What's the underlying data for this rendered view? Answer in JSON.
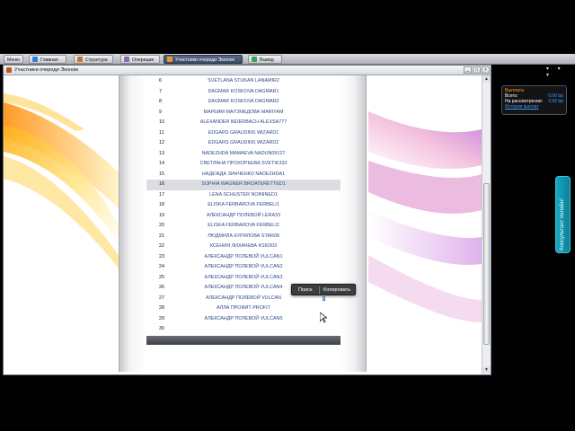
{
  "tabs": [
    {
      "label": "Меню",
      "active": false,
      "color": "#dcdde0"
    },
    {
      "label": "Главная",
      "active": false,
      "color": "#3a7bd5"
    },
    {
      "label": "Структура",
      "active": false,
      "color": "#d0712a"
    },
    {
      "label": "Операции",
      "active": false,
      "color": "#8a6bb8"
    },
    {
      "label": "Участники очереди Эконом",
      "active": true,
      "color": "#e89a2a"
    },
    {
      "label": "Вывод",
      "active": false,
      "color": "#3aa550"
    }
  ],
  "window": {
    "title": "Участники очереди Эконом",
    "minimize": "_",
    "maximize": "□",
    "close": "×"
  },
  "list": {
    "rows": [
      {
        "num": "6",
        "name": "SVETLANA STUKAN LANAMIR2",
        "selected": false
      },
      {
        "num": "7",
        "name": "DAGMAR KOSKOVA DAGMAR1",
        "selected": false
      },
      {
        "num": "8",
        "name": "DAGMAR KOSKOVA DAGMAR2",
        "selected": false
      },
      {
        "num": "9",
        "name": "МАРЬЯМ МАГОМЕДОВА MARIYAM",
        "selected": false
      },
      {
        "num": "10",
        "name": "ALEXANDER BEIERBACH ALEXSA777",
        "selected": false
      },
      {
        "num": "11",
        "name": "EDGARS GRAUDINS WIZARD1",
        "selected": false
      },
      {
        "num": "12",
        "name": "EDGARS GRAUDINS WIZARD2",
        "selected": false
      },
      {
        "num": "13",
        "name": "NADEZHDA MAMAEVA NADUN09127",
        "selected": false
      },
      {
        "num": "14",
        "name": "СВЕТЛАНА ПРОХОРЬЕВА SVETIK333",
        "selected": false
      },
      {
        "num": "15",
        "name": "НАДЕЖДА ЗИНЧЕНКО NADEZHDA1",
        "selected": false
      },
      {
        "num": "16",
        "name": "SOPHIA WAGNER BROATERETTED1",
        "selected": true
      },
      {
        "num": "17",
        "name": "LENA SCHUSTER NOININED1",
        "selected": false
      },
      {
        "num": "18",
        "name": "ELISKA FERBAROVA FERBELI1",
        "selected": false
      },
      {
        "num": "19",
        "name": "АЛЕКСАНДР ПОЛЕВОЙ LERA33",
        "selected": false
      },
      {
        "num": "20",
        "name": "ELISKA FERBAROVA FERBELI2",
        "selected": false
      },
      {
        "num": "21",
        "name": "ЛЮДМИЛА КУРИЛОВА STAR08",
        "selected": false
      },
      {
        "num": "22",
        "name": "КСЕНИЯ ЛИХАЧЕВА KSI0303",
        "selected": false
      },
      {
        "num": "23",
        "name": "АЛЕКСАНДР ПОЛЕВОЙ VULCAN1",
        "selected": false
      },
      {
        "num": "24",
        "name": "АЛЕКСАНДР ПОЛЕВОЙ VULCAN2",
        "selected": false
      },
      {
        "num": "25",
        "name": "АЛЕКСАНДР ПОЛЕВОЙ VULCAN3",
        "selected": false
      },
      {
        "num": "26",
        "name": "АЛЕКСАНДР ПОЛЕВОЙ VULCAN4",
        "selected": false
      },
      {
        "num": "27",
        "name": "АЛЕКСАНДР ПОЛЕВОЙ VULCAN",
        "selected": false
      },
      {
        "num": "28",
        "name": "АЛЛА ПРОФИТ PROFIT",
        "selected": false
      },
      {
        "num": "29",
        "name": "АЛЕКСАНДР ПОЛЕВОЙ VULCAN5",
        "selected": false
      },
      {
        "num": "30",
        "name": "",
        "selected": false
      }
    ]
  },
  "context_menu": {
    "search": "Поиск",
    "copy": "Копировать"
  },
  "balance": {
    "title": "Выплата",
    "total_label": "Всего:",
    "total_value": "0,00 bp",
    "review_label": "На рассмотрении:",
    "review_value": "0,00 bp",
    "link": "История выплат"
  },
  "right_controls": "▾ ▾ ▾",
  "consult": {
    "label": "Консультант онлайн!"
  },
  "colors": {
    "accent_orange": "#ff9a1a",
    "link_blue": "#3c9bff",
    "consult_teal": "#17a7c2"
  }
}
